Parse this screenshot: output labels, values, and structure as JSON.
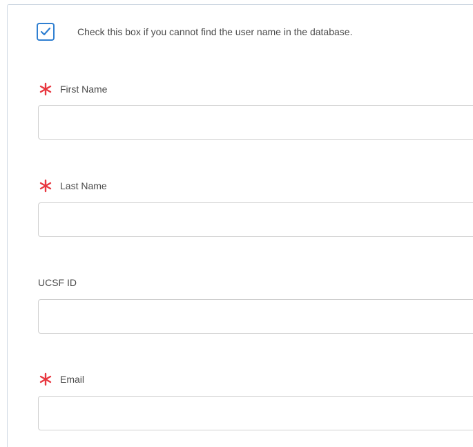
{
  "checkbox": {
    "checked": true,
    "label": "Check this box if you cannot find the user name in the database."
  },
  "fields": [
    {
      "label": "First Name",
      "required": true,
      "value": "",
      "placeholder": ""
    },
    {
      "label": "Last Name",
      "required": true,
      "value": "",
      "placeholder": ""
    },
    {
      "label": "UCSF ID",
      "required": false,
      "value": "",
      "placeholder": ""
    },
    {
      "label": "Email",
      "required": true,
      "value": "",
      "placeholder": ""
    }
  ],
  "colors": {
    "required_star": "#e8363f",
    "checkbox_accent": "#2f7fd1",
    "input_border": "#cfcfcf",
    "label_text": "#4a4a4a"
  },
  "icons": {
    "checkbox_mark": "checkmark-icon",
    "required_marker": "asterisk-icon"
  }
}
